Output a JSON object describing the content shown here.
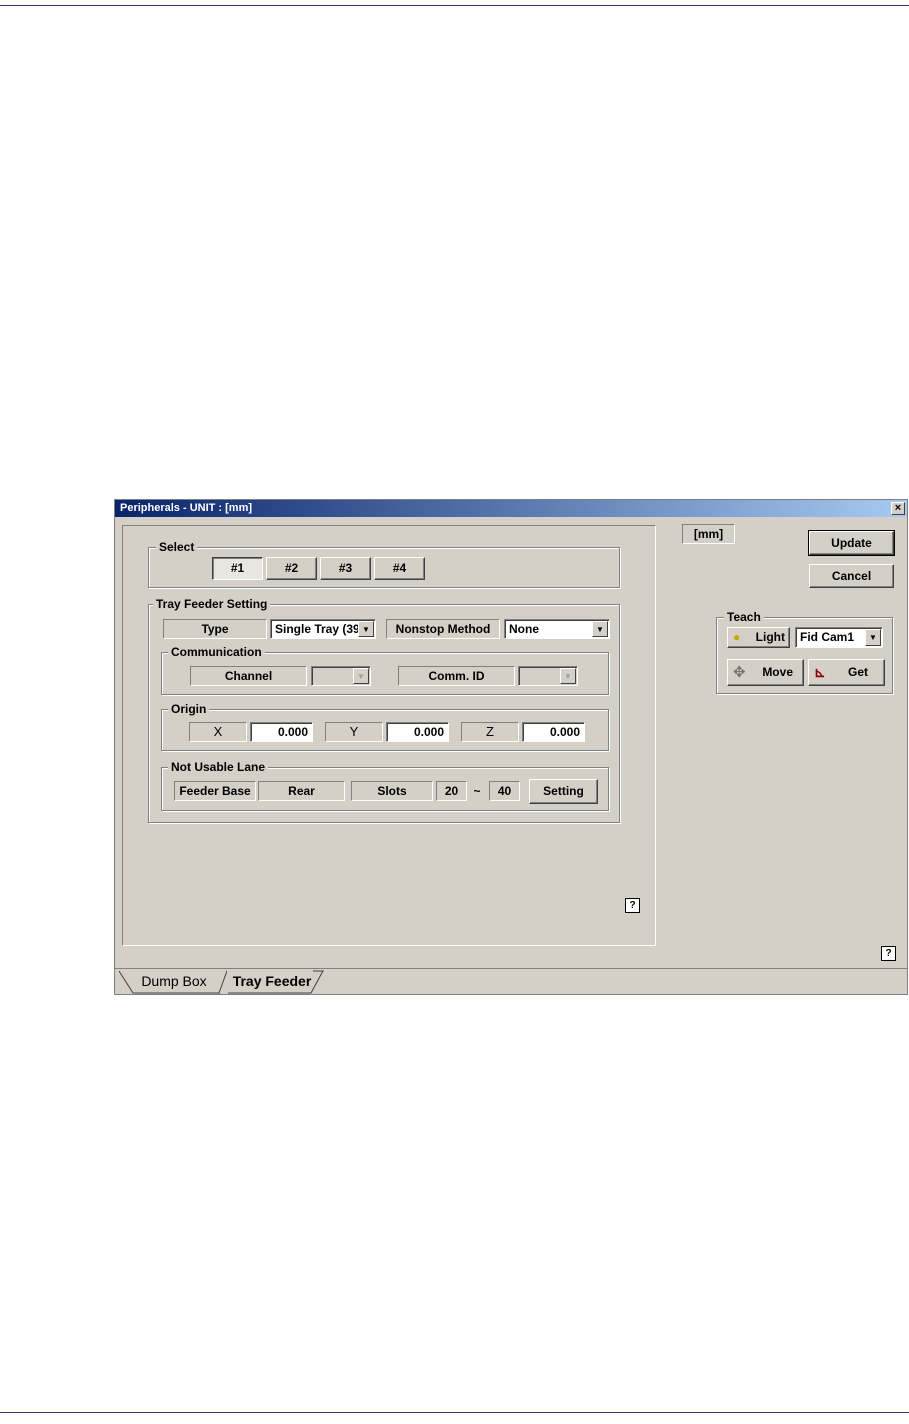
{
  "window": {
    "title": "Peripherals - UNIT : [mm]",
    "close": "×"
  },
  "unit_label": "[mm]",
  "buttons": {
    "update": "Update",
    "cancel": "Cancel"
  },
  "select": {
    "label": "Select",
    "options": [
      "#1",
      "#2",
      "#3",
      "#4"
    ],
    "active": "#1"
  },
  "tray_feeder_setting": {
    "label": "Tray Feeder Setting",
    "type_label": "Type",
    "type_value": "Single Tray (39",
    "nonstop_label": "Nonstop Method",
    "nonstop_value": "None"
  },
  "communication": {
    "label": "Communication",
    "channel_label": "Channel",
    "channel_value": "",
    "comm_id_label": "Comm. ID",
    "comm_id_value": ""
  },
  "origin": {
    "label": "Origin",
    "x_label": "X",
    "x_value": "0.000",
    "y_label": "Y",
    "y_value": "0.000",
    "z_label": "Z",
    "z_value": "0.000"
  },
  "not_usable_lane": {
    "label": "Not Usable Lane",
    "feeder_base_label": "Feeder Base",
    "feeder_base_value": "Rear",
    "slots_label": "Slots",
    "slot_from": "20",
    "slot_sep": "~",
    "slot_to": "40",
    "setting_button": "Setting"
  },
  "teach": {
    "label": "Teach",
    "light_button": "Light",
    "camera_value": "Fid Cam1",
    "move_button": "Move",
    "get_button": "Get"
  },
  "help_glyph": "?",
  "tabs": [
    {
      "label": "Dump Box",
      "active": false
    },
    {
      "label": "Tray Feeder",
      "active": true
    }
  ]
}
